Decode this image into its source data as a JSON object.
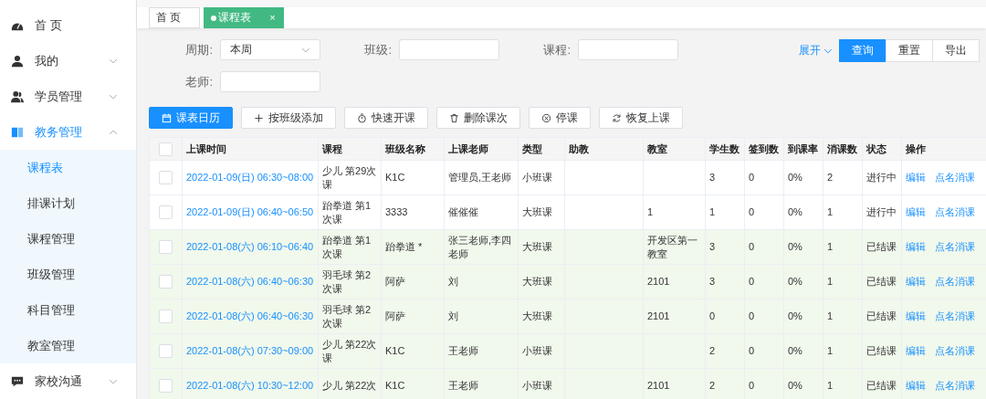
{
  "sidebar": {
    "items": [
      {
        "label": "首 页",
        "selected": false
      },
      {
        "label": "我的",
        "selected": false,
        "expanded": false
      },
      {
        "label": "学员管理",
        "selected": false,
        "expanded": false
      },
      {
        "label": "教务管理",
        "selected": true,
        "expanded": true,
        "children": [
          {
            "label": "课程表",
            "selected": true
          },
          {
            "label": "排课计划",
            "selected": false
          },
          {
            "label": "课程管理",
            "selected": false
          },
          {
            "label": "班级管理",
            "selected": false
          },
          {
            "label": "科目管理",
            "selected": false
          },
          {
            "label": "教室管理",
            "selected": false
          }
        ]
      },
      {
        "label": "家校沟通",
        "selected": false,
        "expanded": false
      }
    ]
  },
  "tabs": [
    {
      "label": "首 页",
      "selected": false
    },
    {
      "label": "课程表",
      "selected": true,
      "close": "×"
    }
  ],
  "filters": [
    {
      "label": "周期:",
      "kind": "select",
      "value": "本周"
    },
    {
      "label": "班级:",
      "kind": "input"
    },
    {
      "label": "课程:",
      "kind": "input"
    },
    {
      "label": "老师:",
      "kind": "input"
    }
  ],
  "expand_link": "展开",
  "search_buttons": [
    {
      "label": "查询",
      "primary": true
    },
    {
      "label": "重置",
      "primary": false
    },
    {
      "label": "导出",
      "primary": false
    }
  ],
  "toolbar": [
    {
      "label": "课表日历",
      "primary": true
    },
    {
      "label": "按班级添加",
      "primary": false
    },
    {
      "label": "快速开课",
      "primary": false
    },
    {
      "label": "删除课次",
      "primary": false
    },
    {
      "label": "停课",
      "primary": false
    },
    {
      "label": "恢复上课",
      "primary": false
    }
  ],
  "table": {
    "header_checked": false,
    "columns": [
      "上课时间",
      "课程",
      "班级名称",
      "上课老师",
      "类型",
      "助教",
      "教室",
      "学生数",
      "签到数",
      "到课率",
      "消课数",
      "状态",
      "操作"
    ],
    "rows": [
      {
        "checked": false,
        "highlighted": false,
        "time": "2022-01-09(日) 06:30~08:00",
        "course": "少儿 第29次课",
        "class": "K1C",
        "teacher": "管理员,王老师",
        "type": "小班课",
        "students": "3",
        "signed": "0",
        "rate": "0%",
        "consumed": "2",
        "status": "进行中",
        "actions": [
          "编辑",
          "点名消课"
        ]
      },
      {
        "checked": false,
        "highlighted": false,
        "time": "2022-01-09(日) 06:40~06:50",
        "course": "跆拳道 第1次课",
        "class": "3333",
        "teacher": "催催催",
        "type": "大班课",
        "room": "1",
        "students": "1",
        "signed": "0",
        "rate": "0%",
        "consumed": "1",
        "status": "进行中",
        "actions": [
          "编辑",
          "点名消课"
        ]
      },
      {
        "checked": false,
        "highlighted": true,
        "time": "2022-01-08(六) 06:10~06:40",
        "course": "跆拳道 第1次课",
        "class": "跆拳道 *",
        "teacher": "张三老师,李四老师",
        "type": "大班课",
        "room": "开发区第一教室",
        "students": "3",
        "signed": "0",
        "rate": "0%",
        "consumed": "1",
        "status": "已结课",
        "actions": [
          "编辑",
          "点名消课"
        ]
      },
      {
        "checked": false,
        "highlighted": true,
        "time": "2022-01-08(六) 06:40~06:30",
        "course": "羽毛球 第2次课",
        "class": "阿萨",
        "teacher": "刘",
        "type": "大班课",
        "room": "2101",
        "students": "3",
        "signed": "0",
        "rate": "0%",
        "consumed": "1",
        "status": "已结课",
        "actions": [
          "编辑",
          "点名消课"
        ]
      },
      {
        "checked": false,
        "highlighted": true,
        "time": "2022-01-08(六) 06:40~06:30",
        "course": "羽毛球 第2次课",
        "class": "阿萨",
        "teacher": "刘",
        "type": "大班课",
        "room": "2101",
        "students": "0",
        "signed": "0",
        "rate": "0%",
        "consumed": "1",
        "status": "已结课",
        "actions": [
          "编辑",
          "点名消课"
        ]
      },
      {
        "checked": false,
        "highlighted": true,
        "time": "2022-01-08(六) 07:30~09:00",
        "course": "少儿 第22次课",
        "class": "K1C",
        "teacher": "王老师",
        "type": "小班课",
        "students": "2",
        "signed": "0",
        "rate": "0%",
        "consumed": "1",
        "status": "已结课",
        "actions": [
          "编辑",
          "点名消课"
        ]
      },
      {
        "checked": false,
        "highlighted": true,
        "time": "2022-01-08(六) 10:30~12:00",
        "course": "少儿 第22次",
        "class": "K1C",
        "teacher": "王老师",
        "type": "小班课",
        "room": "2101",
        "students": "2",
        "signed": "0",
        "rate": "0%",
        "consumed": "1",
        "status": "已结课",
        "actions": [
          "编辑",
          "点名消课"
        ]
      }
    ]
  }
}
